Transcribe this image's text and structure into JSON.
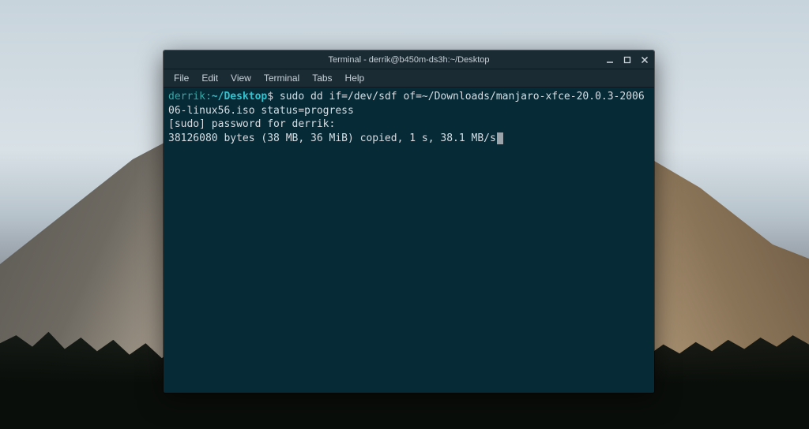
{
  "window": {
    "title": "Terminal - derrik@b450m-ds3h:~/Desktop"
  },
  "menubar": {
    "items": [
      "File",
      "Edit",
      "View",
      "Terminal",
      "Tabs",
      "Help"
    ]
  },
  "terminal": {
    "prompt_user": "derrik:",
    "prompt_path": "~/Desktop",
    "prompt_symbol": "$",
    "command": "sudo dd if=/dev/sdf of=~/Downloads/manjaro-xfce-20.0.3-200606-linux56.iso status=progress",
    "line2": "[sudo] password for derrik:",
    "line3": "38126080 bytes (38 MB, 36 MiB) copied, 1 s, 38.1 MB/s"
  }
}
